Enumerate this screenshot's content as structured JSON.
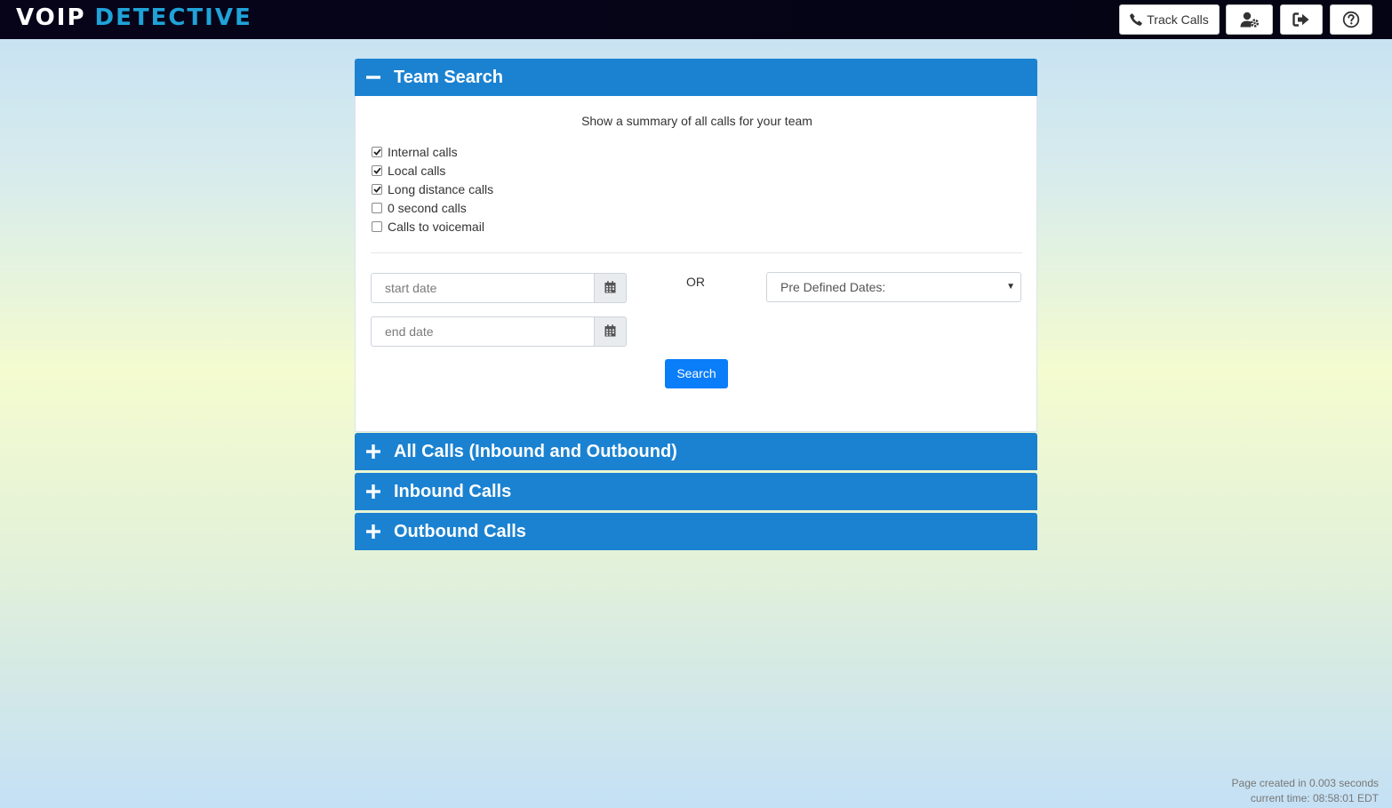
{
  "header": {
    "logo_voip": "VOIP",
    "logo_detective": "DETECTIVE",
    "track_calls_label": "Track Calls",
    "icons": [
      "phone-icon",
      "user-gear-icon",
      "logout-icon",
      "help-icon"
    ]
  },
  "team_search": {
    "title": "Team Search",
    "summary": "Show a summary of all calls for your team",
    "checkboxes": [
      {
        "label": "Internal calls",
        "checked": true
      },
      {
        "label": "Local calls",
        "checked": true
      },
      {
        "label": "Long distance calls",
        "checked": true
      },
      {
        "label": "0 second calls",
        "checked": false
      },
      {
        "label": "Calls to voicemail",
        "checked": false
      }
    ],
    "start_date_placeholder": "start date",
    "end_date_placeholder": "end date",
    "or_text": "OR",
    "predefined_dates": "Pre Defined Dates:",
    "search_label": "Search"
  },
  "panels": [
    {
      "title": "All Calls (Inbound and Outbound)"
    },
    {
      "title": "Inbound Calls"
    },
    {
      "title": "Outbound Calls"
    }
  ],
  "footer": {
    "page_created": "Page created in 0.003 seconds",
    "current_time": "current time: 08:58:01 EDT"
  },
  "colors": {
    "header_bg": "#07041a",
    "logo_accent": "#1fa3d8",
    "panel_header": "#1b82d1",
    "search_button": "#0a7df8"
  }
}
